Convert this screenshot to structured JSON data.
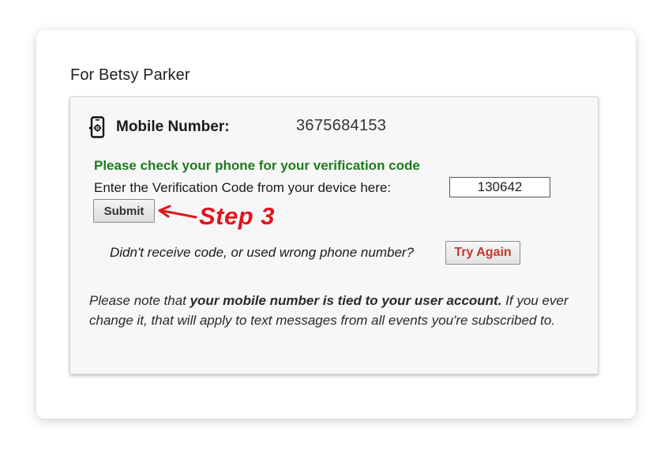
{
  "account": {
    "for_label": "For Betsy Parker"
  },
  "mobile": {
    "label_bold": "Mobile",
    "label_rest": " Number:",
    "number": "3675684153",
    "icon": "mobile-phone-icon"
  },
  "verification": {
    "check_message": "Please check your phone for your verification code",
    "enter_label": "Enter the Verification Code from your device here:",
    "code_value": "130642",
    "submit_label": "Submit"
  },
  "annotation": {
    "step_label": "Step 3",
    "arrow_icon": "left-arrow-icon",
    "color": "#e0151b"
  },
  "retry": {
    "question": "Didn't receive code, or used wrong phone number?",
    "try_again_label": "Try Again"
  },
  "note": {
    "part1": "Please note that ",
    "bold": "your mobile number is tied to your user account.",
    "part2": " If you ever change it, that will apply to text messages from all events you're subscribed to."
  },
  "colors": {
    "success_green": "#1e7a1e",
    "try_again_red": "#c0392b"
  }
}
